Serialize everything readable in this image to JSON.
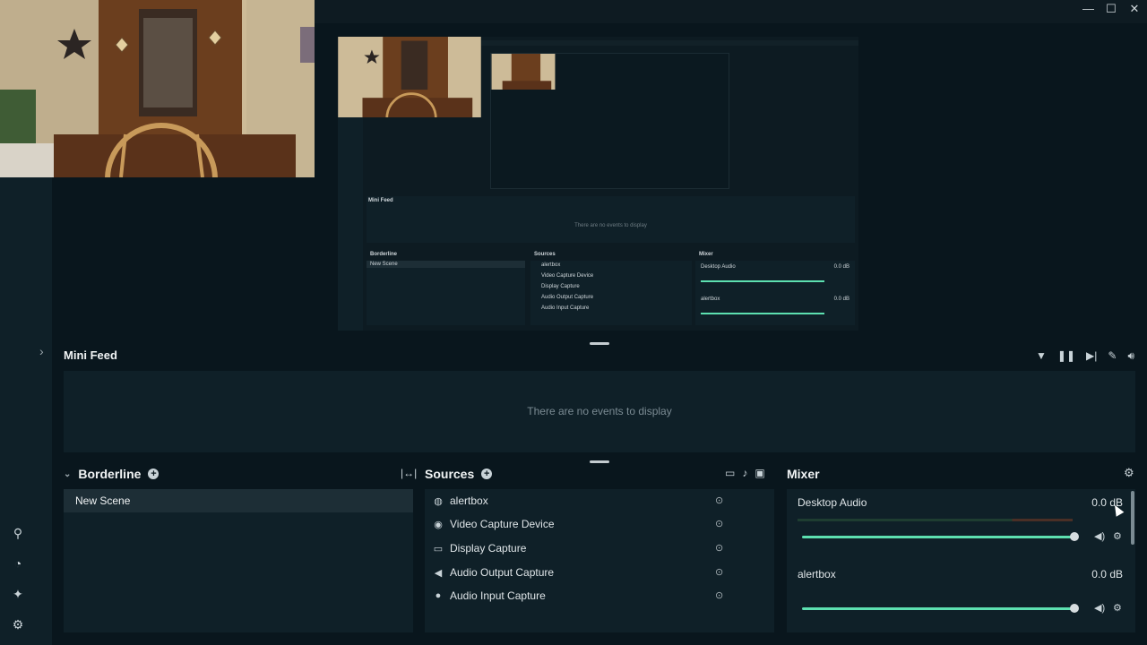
{
  "titlebar": {
    "minimize": "—",
    "maximize": "☐",
    "close": "✕"
  },
  "rail": {
    "icons": [
      "studio-mode-icon",
      "layout-icon",
      "effects-icon",
      "settings-icon"
    ]
  },
  "minifeed": {
    "title": "Mini Feed",
    "empty": "There are no events to display",
    "tools": [
      "filter-icon",
      "pause-icon",
      "skip-icon",
      "mute-alerts-icon",
      "volume-icon"
    ]
  },
  "scenes": {
    "title": "Borderline",
    "items": [
      {
        "label": "New Scene"
      }
    ]
  },
  "sources": {
    "title": "Sources",
    "items": [
      {
        "label": "alertbox",
        "icon": "globe-icon"
      },
      {
        "label": "Video Capture Device",
        "icon": "webcam-icon"
      },
      {
        "label": "Display Capture",
        "icon": "monitor-icon"
      },
      {
        "label": "Audio Output Capture",
        "icon": "speaker-icon"
      },
      {
        "label": "Audio Input Capture",
        "icon": "microphone-icon"
      }
    ]
  },
  "mixer": {
    "title": "Mixer",
    "channels": [
      {
        "name": "Desktop Audio",
        "db": "0.0 dB",
        "level": 1.0
      },
      {
        "name": "alertbox",
        "db": "0.0 dB",
        "level": 1.0
      }
    ]
  },
  "preview": {
    "mini_feed": "Mini Feed",
    "empty": "There are no events to display",
    "scenes_title": "Borderline",
    "scene": "New Scene",
    "sources_title": "Sources",
    "sources": [
      "alertbox",
      "Video Capture Device",
      "Display Capture",
      "Audio Output Capture",
      "Audio Input Capture"
    ],
    "mixer_title": "Mixer",
    "ch1": "Desktop Audio",
    "ch2": "alertbox",
    "db": "0.0 dB"
  },
  "colors": {
    "accent": "#5de0b0",
    "background": "#09161d",
    "panel": "#0f2028"
  }
}
